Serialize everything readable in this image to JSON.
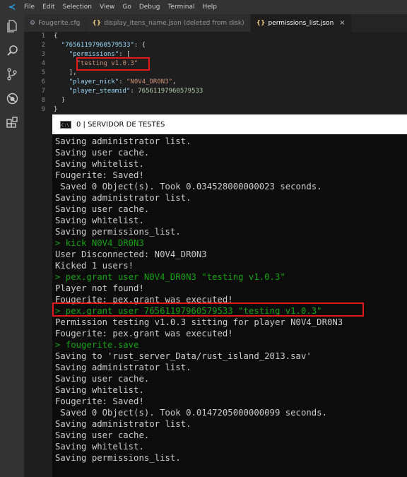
{
  "menubar": {
    "items": [
      "File",
      "Edit",
      "Selection",
      "View",
      "Go",
      "Debug",
      "Terminal",
      "Help"
    ]
  },
  "activity_icons": [
    "files-icon",
    "search-icon",
    "source-control-icon",
    "debug-icon",
    "extensions-icon"
  ],
  "tabs": [
    {
      "label": "Fougerite.cfg",
      "icon": "gear-icon",
      "active": false
    },
    {
      "label": "display_itens_name.json (deleted from disk)",
      "icon": "json-icon",
      "active": false
    },
    {
      "label": "permissions_list.json",
      "icon": "json-icon",
      "active": true
    }
  ],
  "editor": {
    "line_numbers": [
      "1",
      "2",
      "3",
      "4",
      "5",
      "6",
      "7",
      "8",
      "9"
    ],
    "tokens": {
      "l1": "{",
      "l2_key": "\"76561197960579533\"",
      "l2_rest": ": {",
      "l3_key": "\"permissions\"",
      "l3_rest": ": [",
      "l4_val": "\"testing v1.0.3\"",
      "l5": "],",
      "l6_key": "\"player_nick\"",
      "l6_sep": ": ",
      "l6_val": "\"N0V4_DR0N3\"",
      "l6_end": ",",
      "l7_key": "\"player_steamid\"",
      "l7_sep": ": ",
      "l7_val": "76561197960579533",
      "l8": "}",
      "l9": "}"
    }
  },
  "console": {
    "title": "0 | SERVIDOR DE TESTES",
    "icon_text": "C:\\",
    "lines": [
      {
        "text": "Saving administrator list.",
        "color": "gray"
      },
      {
        "text": "Saving user cache.",
        "color": "gray"
      },
      {
        "text": "Saving whitelist.",
        "color": "gray"
      },
      {
        "text": "Fougerite: Saved!",
        "color": "gray"
      },
      {
        "text": " Saved 0 Object(s). Took 0.034528000000023 seconds.",
        "color": "gray"
      },
      {
        "text": "Saving administrator list.",
        "color": "gray"
      },
      {
        "text": "Saving user cache.",
        "color": "gray"
      },
      {
        "text": "Saving whitelist.",
        "color": "gray"
      },
      {
        "text": "Saving permissions_list.",
        "color": "gray"
      },
      {
        "text": "> kick N0V4_DR0N3",
        "color": "green"
      },
      {
        "text": "User Disconnected: N0V4_DR0N3",
        "color": "gray"
      },
      {
        "text": "Kicked 1 users!",
        "color": "gray"
      },
      {
        "text": "> pex.grant user N0V4_DR0N3 \"testing v1.0.3\"",
        "color": "green"
      },
      {
        "text": "Player not found!",
        "color": "gray"
      },
      {
        "text": "Fougerite: pex.grant was executed!",
        "color": "gray"
      },
      {
        "text": "> pex.grant user 76561197960579533 \"testing v1.0.3\"",
        "color": "green"
      },
      {
        "text": "Permission testing v1.0.3 sitting for player N0V4_DR0N3",
        "color": "gray"
      },
      {
        "text": "Fougerite: pex.grant was executed!",
        "color": "gray"
      },
      {
        "text": "> fougerite.save",
        "color": "green"
      },
      {
        "text": "Saving to 'rust_server_Data/rust_island_2013.sav'",
        "color": "gray"
      },
      {
        "text": "Saving administrator list.",
        "color": "gray"
      },
      {
        "text": "Saving user cache.",
        "color": "gray"
      },
      {
        "text": "Saving whitelist.",
        "color": "gray"
      },
      {
        "text": "Fougerite: Saved!",
        "color": "gray"
      },
      {
        "text": " Saved 0 Object(s). Took 0.0147205000000099 seconds.",
        "color": "gray"
      },
      {
        "text": "Saving administrator list.",
        "color": "gray"
      },
      {
        "text": "Saving user cache.",
        "color": "gray"
      },
      {
        "text": "Saving whitelist.",
        "color": "gray"
      },
      {
        "text": "Saving permissions_list.",
        "color": "gray"
      }
    ]
  },
  "colors": {
    "highlight_box": "#e11919",
    "console_green": "#13a10e",
    "console_gray": "#cccccc"
  }
}
